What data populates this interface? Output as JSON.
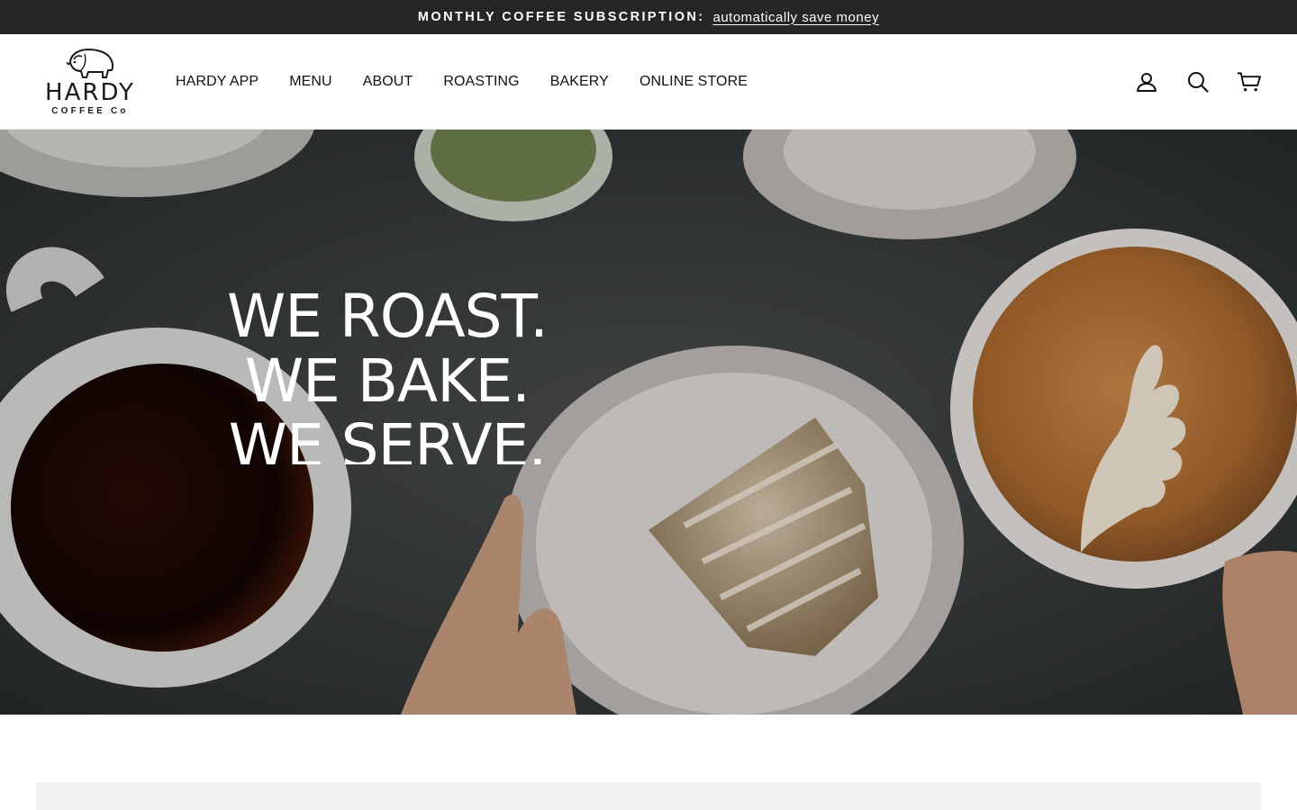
{
  "announcement": {
    "lead": "MONTHLY COFFEE SUBSCRIPTION:",
    "link": "automatically save money"
  },
  "brand": {
    "name": "HARDY",
    "sub": "COFFEE Co"
  },
  "nav": {
    "items": [
      "HARDY APP",
      "MENU",
      "ABOUT",
      "ROASTING",
      "BAKERY",
      "ONLINE STORE"
    ]
  },
  "header_icons": [
    "account-icon",
    "search-icon",
    "cart-icon"
  ],
  "hero": {
    "lines": [
      "WE ROAST.",
      "WE BAKE.",
      "WE SERVE."
    ]
  },
  "colors": {
    "announcement_bg": "#262626",
    "text": "#111111",
    "hero_overlay_text": "#ffffff",
    "section_bg": "#f2f2f2"
  }
}
